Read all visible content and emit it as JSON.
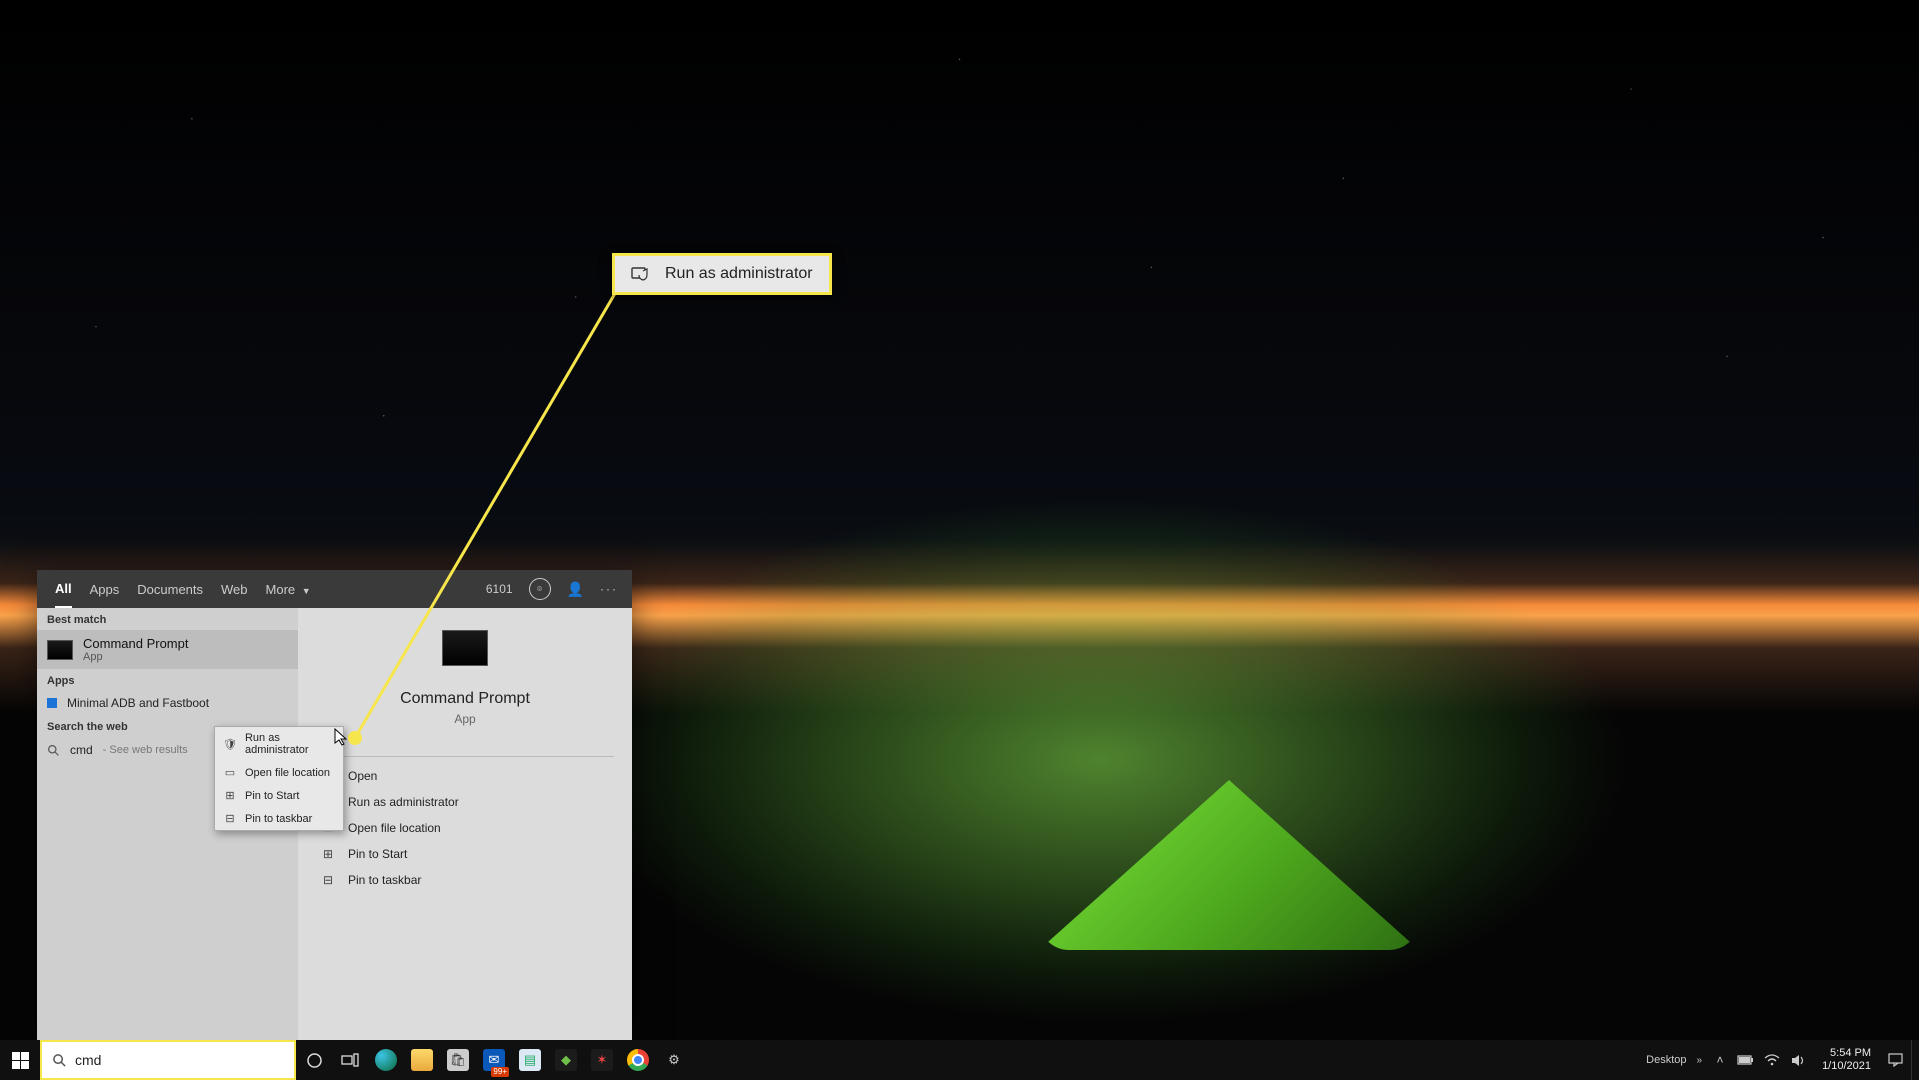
{
  "search": {
    "tabs": {
      "all": "All",
      "apps": "Apps",
      "documents": "Documents",
      "web": "Web",
      "more": "More"
    },
    "points": "6101",
    "sections": {
      "best_match": "Best match",
      "apps": "Apps",
      "search_web": "Search the web"
    },
    "best_match": {
      "title": "Command Prompt",
      "subtitle": "App"
    },
    "apps_list": {
      "item0": "Minimal ADB and Fastboot"
    },
    "web": {
      "term": "cmd",
      "hint": " - See web results"
    },
    "detail": {
      "title": "Command Prompt",
      "subtitle": "App",
      "actions": {
        "open": "Open",
        "run_admin": "Run as administrator",
        "open_loc": "Open file location",
        "pin_start": "Pin to Start",
        "pin_taskbar": "Pin to taskbar"
      }
    }
  },
  "context_menu": {
    "run_admin": "Run as administrator",
    "open_loc": "Open file location",
    "pin_start": "Pin to Start",
    "pin_taskbar": "Pin to taskbar"
  },
  "callout": {
    "label": "Run as administrator"
  },
  "search_box": {
    "value": "cmd"
  },
  "taskbar": {
    "desktop_label": "Desktop",
    "mail_badge": "99+",
    "clock": {
      "time": "5:54 PM",
      "date": "1/10/2021"
    }
  }
}
